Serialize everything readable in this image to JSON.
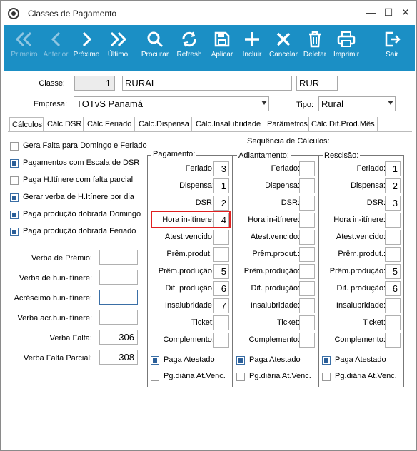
{
  "window": {
    "title": "Classes de Pagamento"
  },
  "toolbar": {
    "primeiro": "Primeiro",
    "anterior": "Anterior",
    "proximo": "Próximo",
    "ultimo": "Último",
    "procurar": "Procurar",
    "refresh": "Refresh",
    "aplicar": "Aplicar",
    "incluir": "Incluir",
    "cancelar": "Cancelar",
    "deletar": "Deletar",
    "imprimir": "Imprimir",
    "sair": "Sair"
  },
  "form": {
    "classe_label": "Classe:",
    "classe_code": "1",
    "classe_name": "RURAL",
    "classe_abbr": "RUR",
    "empresa_label": "Empresa:",
    "empresa_value": "TOTvS Panamá",
    "tipo_label": "Tipo:",
    "tipo_value": "Rural"
  },
  "tabs": [
    "Cálculos",
    "Cálc.DSR",
    "Cálc.Feriado",
    "Cálc.Dispensa",
    "Cálc.Insalubridade",
    "Parâmetros",
    "Cálc.Dif.Prod.Mês"
  ],
  "options": [
    {
      "label": "Gera Falta para Domingo e Feriado",
      "checked": false
    },
    {
      "label": "Pagamentos com Escala de DSR",
      "checked": true
    },
    {
      "label": "Paga H.Itínere com falta parcial",
      "checked": false
    },
    {
      "label": "Gerar verba de H.Itínere por dia",
      "checked": true
    },
    {
      "label": "Paga produção dobrada Domingo",
      "checked": true
    },
    {
      "label": "Paga produção dobrada Feriado",
      "checked": true
    }
  ],
  "verbas": {
    "premio_label": "Verba de Prêmio:",
    "premio_value": "",
    "hitinere_label": "Verba de h.in-itínere:",
    "hitinere_value": "",
    "acrescimo_label": "Acréscimo h.in-itínere:",
    "acrescimo_value": "",
    "acr_label": "Verba acr.h.in-itínere:",
    "acr_value": "",
    "falta_label": "Verba Falta:",
    "falta_value": "306",
    "falta_parcial_label": "Verba Falta Parcial:",
    "falta_parcial_value": "308"
  },
  "sequence": {
    "title": "Sequência de Cálculos:",
    "row_labels": [
      "Feriado:",
      "Dispensa:",
      "DSR:",
      "Hora in-itínere:",
      "Atest.vencido:",
      "Prêm.produt.:",
      "Prêm.produção:",
      "Dif. produção:",
      "Insalubridade:",
      "Ticket:",
      "Complemento:"
    ],
    "pagamento": {
      "title": "Pagamento:",
      "values": [
        "3",
        "1",
        "2",
        "4",
        "",
        "",
        "5",
        "6",
        "7",
        "",
        ""
      ],
      "paga_atestado": "Paga Atestado",
      "paga_atestado_checked": true,
      "pg_diaria": "Pg.diária At.Venc.",
      "pg_diaria_checked": false
    },
    "adiantamento": {
      "title": "Adiantamento:",
      "values": [
        "",
        "",
        "",
        "",
        "",
        "",
        "",
        "",
        "",
        "",
        ""
      ],
      "paga_atestado": "Paga Atestado",
      "paga_atestado_checked": true,
      "pg_diaria": "Pg.diária At.Venc.",
      "pg_diaria_checked": false
    },
    "rescisao": {
      "title": "Rescisão:",
      "values": [
        "1",
        "2",
        "3",
        "",
        "",
        "",
        "5",
        "6",
        "",
        "",
        ""
      ],
      "paga_atestado": "Paga Atestado",
      "paga_atestado_checked": true,
      "pg_diaria": "Pg.diária At.Venc.",
      "pg_diaria_checked": false
    }
  }
}
